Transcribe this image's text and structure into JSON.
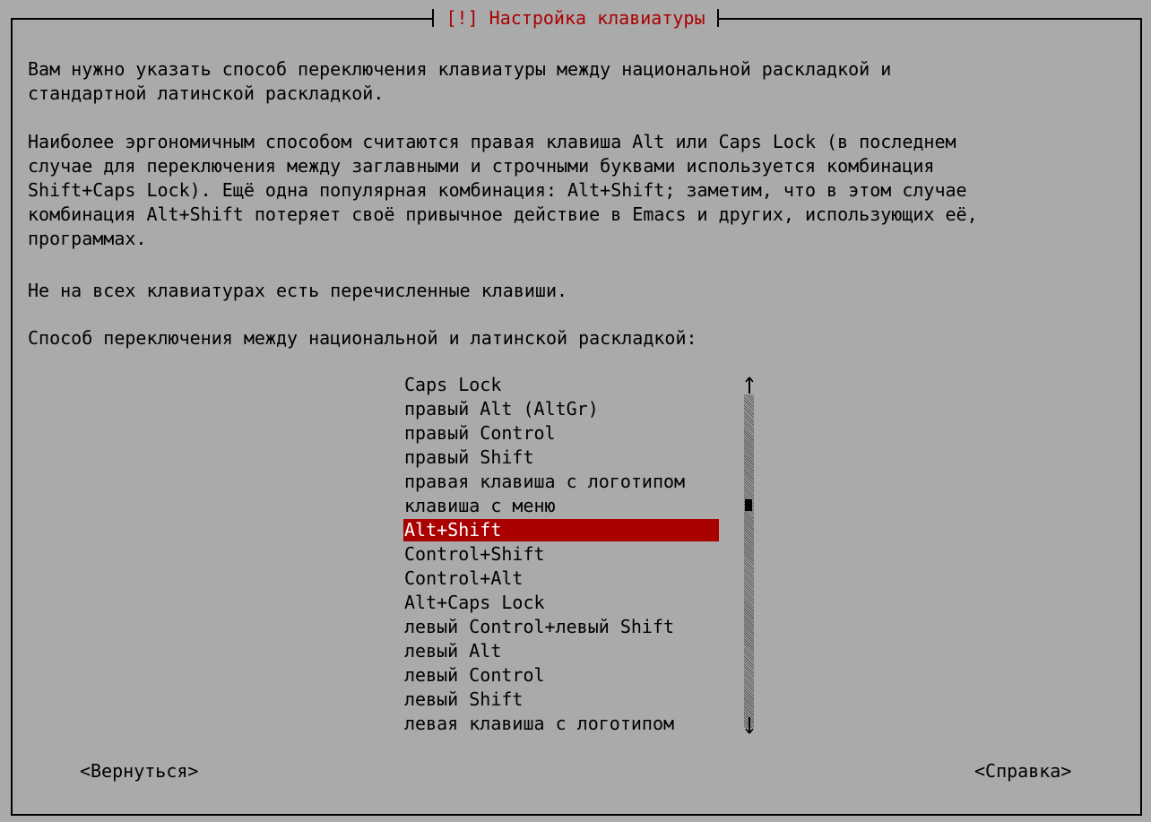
{
  "dialog": {
    "title": "[!] Настройка клавиатуры"
  },
  "paragraphs": [
    "Вам нужно указать способ переключения клавиатуры между национальной раскладкой и\nстандартной латинской раскладкой.",
    "Наиболее эргономичным способом считаются правая клавиша Alt или Caps Lock (в последнем\nслучае для переключения между заглавными и строчными буквами используется комбинация\nShift+Caps Lock). Ещё одна популярная комбинация: Alt+Shift; заметим, что в этом случае\nкомбинация Alt+Shift потеряет своё привычное действие в Emacs и других, использующих её,\nпрограммах.",
    "Не на всех клавиатурах есть перечисленные клавиши.",
    "Способ переключения между национальной и латинской раскладкой:"
  ],
  "options": [
    {
      "label": "Caps Lock"
    },
    {
      "label": "правый Alt (AltGr)"
    },
    {
      "label": "правый Control"
    },
    {
      "label": "правый Shift"
    },
    {
      "label": "правая клавиша с логотипом"
    },
    {
      "label": "клавиша с меню"
    },
    {
      "label": "Alt+Shift",
      "selected": true
    },
    {
      "label": "Control+Shift"
    },
    {
      "label": "Control+Alt"
    },
    {
      "label": "Alt+Caps Lock"
    },
    {
      "label": "левый Control+левый Shift"
    },
    {
      "label": "левый Alt"
    },
    {
      "label": "левый Control"
    },
    {
      "label": "левый Shift"
    },
    {
      "label": "левая клавиша с логотипом"
    }
  ],
  "buttons": {
    "back": "<Вернуться>",
    "help": "<Справка>"
  },
  "colors": {
    "background": "#aaaaaa",
    "accent": "#aa0000",
    "selected_text": "#ffffff"
  }
}
